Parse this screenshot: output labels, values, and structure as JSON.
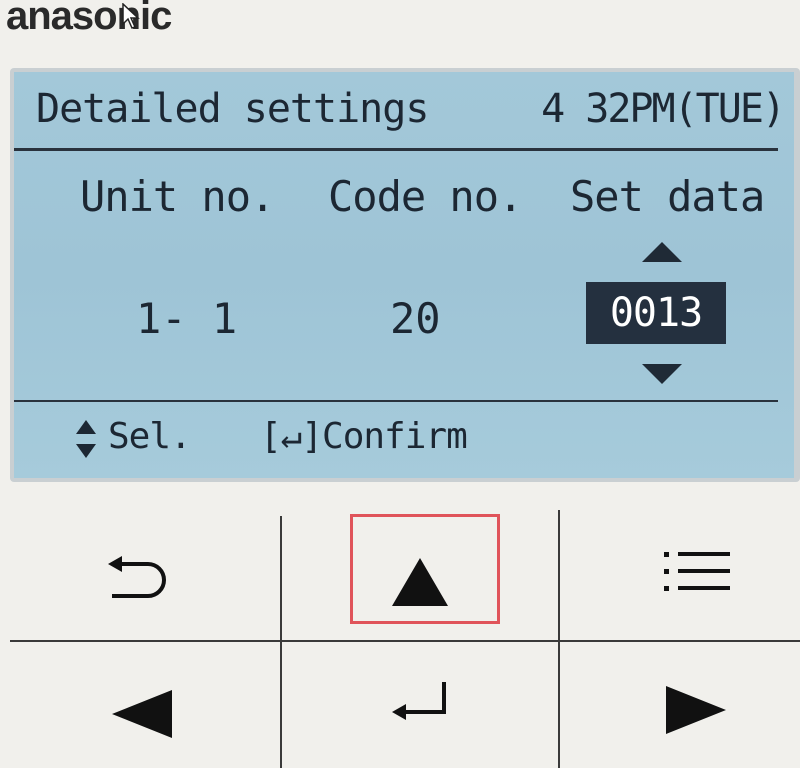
{
  "brand": "anasonic",
  "lcd": {
    "title": "Detailed settings",
    "time": "4 32PM(TUE)",
    "columns": [
      "Unit no.",
      "Code no.",
      "Set data"
    ],
    "unit_no": "1- 1",
    "code_no": "20",
    "set_data": "0013",
    "footer_sel": "Sel.",
    "footer_confirm": "[↵]Confirm"
  },
  "keys": {
    "back": "back-icon",
    "up": "up-arrow-icon",
    "menu": "menu-list-icon",
    "left": "left-arrow-icon",
    "enter": "enter-icon",
    "right": "right-arrow-icon"
  },
  "colors": {
    "lcd_background": "#a3c8d9",
    "lcd_text": "#1c2733",
    "highlight": "#e0545a"
  }
}
